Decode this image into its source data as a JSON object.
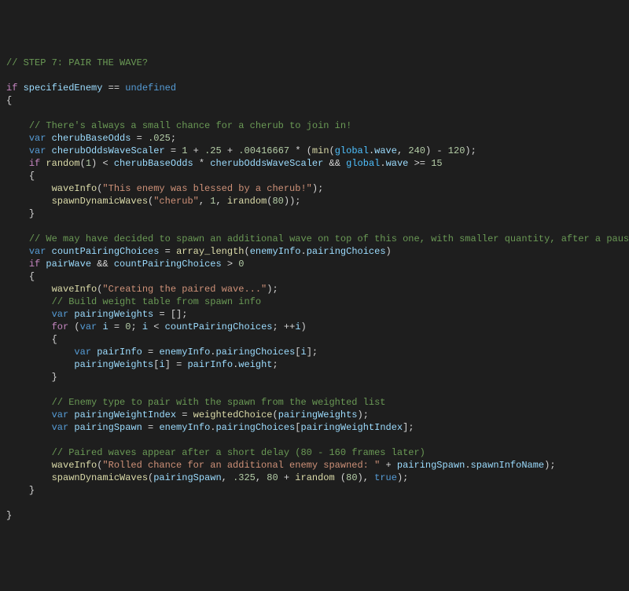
{
  "lines": {
    "l1_comment": "// STEP 7: PAIR THE WAVE?",
    "l3_if": "if",
    "l3_specifiedEnemy": "specifiedEnemy",
    "l3_eq": "==",
    "l3_undefined": "undefined",
    "l6_comment": "// There's always a small chance for a cherub to join in!",
    "l7_var": "var",
    "l7_cherubBaseOdds": "cherubBaseOdds",
    "l7_eq": "=",
    "l7_val": ".025",
    "l8_var": "var",
    "l8_cherubOddsWaveScaler": "cherubOddsWaveScaler",
    "l8_eq": "=",
    "l8_1": "1",
    "l8_plus1": "+",
    "l8_p25": ".25",
    "l8_plus2": "+",
    "l8_00416667": ".00416667",
    "l8_star": "*",
    "l8_min": "min",
    "l8_global1": "global",
    "l8_wave1": "wave",
    "l8_240": "240",
    "l8_minus": "-",
    "l8_120": "120",
    "l9_if": "if",
    "l9_random": "random",
    "l9_1": "1",
    "l9_lt": "<",
    "l9_cherubBaseOdds": "cherubBaseOdds",
    "l9_star": "*",
    "l9_cherubOddsWaveScaler": "cherubOddsWaveScaler",
    "l9_and": "&&",
    "l9_global": "global",
    "l9_wave": "wave",
    "l9_ge": ">=",
    "l9_15": "15",
    "l11_waveInfo": "waveInfo",
    "l11_str": "\"This enemy was blessed by a cherub!\"",
    "l12_spawnDynamicWaves": "spawnDynamicWaves",
    "l12_str": "\"cherub\"",
    "l12_1": "1",
    "l12_irandom": "irandom",
    "l12_80": "80",
    "l15_comment": "// We may have decided to spawn an additional wave on top of this one, with smaller quantity, after a pause",
    "l16_var": "var",
    "l16_countPairingChoices": "countPairingChoices",
    "l16_eq": "=",
    "l16_array_length": "array_length",
    "l16_enemyInfo": "enemyInfo",
    "l16_pairingChoices": "pairingChoices",
    "l17_if": "if",
    "l17_pairWave": "pairWave",
    "l17_and": "&&",
    "l17_countPairingChoices": "countPairingChoices",
    "l17_gt": ">",
    "l17_0": "0",
    "l19_waveInfo": "waveInfo",
    "l19_str": "\"Creating the paired wave...\"",
    "l20_comment": "// Build weight table from spawn info",
    "l21_var": "var",
    "l21_pairingWeights": "pairingWeights",
    "l21_eq": "=",
    "l22_for": "for",
    "l22_var": "var",
    "l22_i": "i",
    "l22_eq": "=",
    "l22_0": "0",
    "l22_i2": "i",
    "l22_lt": "<",
    "l22_countPairingChoices": "countPairingChoices",
    "l22_pp": "++",
    "l22_i3": "i",
    "l24_var": "var",
    "l24_pairInfo": "pairInfo",
    "l24_eq": "=",
    "l24_enemyInfo": "enemyInfo",
    "l24_pairingChoices": "pairingChoices",
    "l24_i": "i",
    "l25_pairingWeights": "pairingWeights",
    "l25_i": "i",
    "l25_eq": "=",
    "l25_pairInfo": "pairInfo",
    "l25_weight": "weight",
    "l28_comment": "// Enemy type to pair with the spawn from the weighted list",
    "l29_var": "var",
    "l29_pairingWeightIndex": "pairingWeightIndex",
    "l29_eq": "=",
    "l29_weightedChoice": "weightedChoice",
    "l29_pairingWeights": "pairingWeights",
    "l30_var": "var",
    "l30_pairingSpawn": "pairingSpawn",
    "l30_eq": "=",
    "l30_enemyInfo": "enemyInfo",
    "l30_pairingChoices": "pairingChoices",
    "l30_pairingWeightIndex": "pairingWeightIndex",
    "l32_comment": "// Paired waves appear after a short delay (80 - 160 frames later)",
    "l33_waveInfo": "waveInfo",
    "l33_str": "\"Rolled chance for an additional enemy spawned: \"",
    "l33_plus": "+",
    "l33_pairingSpawn": "pairingSpawn",
    "l33_spawnInfoName": "spawnInfoName",
    "l34_spawnDynamicWaves": "spawnDynamicWaves",
    "l34_pairingSpawn": "pairingSpawn",
    "l34_p325": ".325",
    "l34_80": "80",
    "l34_plus": "+",
    "l34_irandom": "irandom",
    "l34_80b": "80",
    "l34_true": "true"
  }
}
